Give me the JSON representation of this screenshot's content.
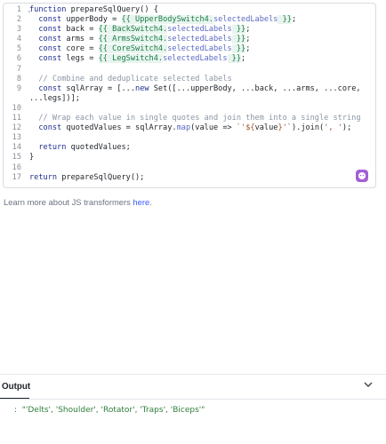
{
  "editor": {
    "lines": [
      {
        "num": "1",
        "segments": [
          {
            "t": "kw",
            "v": "function "
          },
          {
            "t": "",
            "v": "prepareSqlQuery() {"
          }
        ]
      },
      {
        "num": "2",
        "segments": [
          {
            "t": "",
            "v": "  "
          },
          {
            "t": "kw",
            "v": "const "
          },
          {
            "t": "",
            "v": "upperBody = "
          },
          {
            "t": "tpl",
            "v": "{{ UpperBodySwitch4."
          },
          {
            "t": "prop",
            "v": "selectedLabels"
          },
          {
            "t": "tpl",
            "v": " }}"
          },
          {
            "t": "",
            "v": ";"
          }
        ]
      },
      {
        "num": "3",
        "segments": [
          {
            "t": "",
            "v": "  "
          },
          {
            "t": "kw",
            "v": "const "
          },
          {
            "t": "",
            "v": "back = "
          },
          {
            "t": "tpl",
            "v": "{{ BackSwitch4."
          },
          {
            "t": "prop",
            "v": "selectedLabels"
          },
          {
            "t": "tpl",
            "v": " }}"
          },
          {
            "t": "",
            "v": ";"
          }
        ]
      },
      {
        "num": "4",
        "segments": [
          {
            "t": "",
            "v": "  "
          },
          {
            "t": "kw",
            "v": "const "
          },
          {
            "t": "",
            "v": "arms = "
          },
          {
            "t": "tpl",
            "v": "{{ ArmsSwitch4."
          },
          {
            "t": "prop",
            "v": "selectedLabels"
          },
          {
            "t": "tpl",
            "v": " }}"
          },
          {
            "t": "",
            "v": ";"
          }
        ]
      },
      {
        "num": "5",
        "segments": [
          {
            "t": "",
            "v": "  "
          },
          {
            "t": "kw",
            "v": "const "
          },
          {
            "t": "",
            "v": "core = "
          },
          {
            "t": "tpl",
            "v": "{{ CoreSwitch4."
          },
          {
            "t": "prop",
            "v": "selectedLabels"
          },
          {
            "t": "tpl",
            "v": " }}"
          },
          {
            "t": "",
            "v": ";"
          }
        ]
      },
      {
        "num": "6",
        "segments": [
          {
            "t": "",
            "v": "  "
          },
          {
            "t": "kw",
            "v": "const "
          },
          {
            "t": "",
            "v": "legs = "
          },
          {
            "t": "tpl",
            "v": "{{ LegSwitch4."
          },
          {
            "t": "prop",
            "v": "selectedLabels"
          },
          {
            "t": "tpl",
            "v": " }}"
          },
          {
            "t": "",
            "v": ";"
          }
        ]
      },
      {
        "num": "7",
        "segments": []
      },
      {
        "num": "8",
        "segments": [
          {
            "t": "",
            "v": "  "
          },
          {
            "t": "cm",
            "v": "// Combine and deduplicate selected labels"
          }
        ]
      },
      {
        "num": "9",
        "segments": [
          {
            "t": "",
            "v": "  "
          },
          {
            "t": "kw",
            "v": "const "
          },
          {
            "t": "",
            "v": "sqlArray = [..."
          },
          {
            "t": "kw",
            "v": "new "
          },
          {
            "t": "",
            "v": "Set([...upperBody, ...back, ...arms, ...core,"
          }
        ]
      },
      {
        "num": "",
        "segments": [
          {
            "t": "",
            "v": "...legs])];"
          }
        ]
      },
      {
        "num": "10",
        "segments": []
      },
      {
        "num": "11",
        "segments": [
          {
            "t": "",
            "v": "  "
          },
          {
            "t": "cm",
            "v": "// Wrap each value in single quotes and join them into a single string"
          }
        ]
      },
      {
        "num": "12",
        "segments": [
          {
            "t": "",
            "v": "  "
          },
          {
            "t": "kw",
            "v": "const "
          },
          {
            "t": "",
            "v": "quotedValues = sqlArray."
          },
          {
            "t": "prop",
            "v": "map"
          },
          {
            "t": "",
            "v": "(value => "
          },
          {
            "t": "str",
            "v": "`'${"
          },
          {
            "t": "",
            "v": "value"
          },
          {
            "t": "str",
            "v": "}'`"
          },
          {
            "t": "",
            "v": ").join("
          },
          {
            "t": "str",
            "v": "', '"
          },
          {
            "t": "",
            "v": ");"
          }
        ]
      },
      {
        "num": "13",
        "segments": []
      },
      {
        "num": "14",
        "segments": [
          {
            "t": "",
            "v": "  "
          },
          {
            "t": "kw",
            "v": "return "
          },
          {
            "t": "",
            "v": "quotedValues;"
          }
        ]
      },
      {
        "num": "15",
        "segments": [
          {
            "t": "",
            "v": "}"
          }
        ]
      },
      {
        "num": "16",
        "segments": []
      },
      {
        "num": "17",
        "segments": [
          {
            "t": "kw",
            "v": "return "
          },
          {
            "t": "",
            "v": "prepareSqlQuery();"
          }
        ]
      }
    ]
  },
  "learn_more": {
    "text": "Learn more about JS transformers ",
    "link": "here",
    "suffix": "."
  },
  "output": {
    "title": "Output",
    "value": ":  \"'Delts', 'Shoulder', 'Rotator', 'Traps', 'Biceps'\""
  },
  "colors": {
    "keyword": "#1f2d8f",
    "template": "#1c7c4a",
    "result": "#2f7d3a",
    "link": "#3d5afe",
    "assistant_button": "#a35fd6"
  },
  "icons": {
    "fold": "chevron-down-icon",
    "assistant": "ai-assistant-icon",
    "collapse": "chevron-down-icon"
  }
}
